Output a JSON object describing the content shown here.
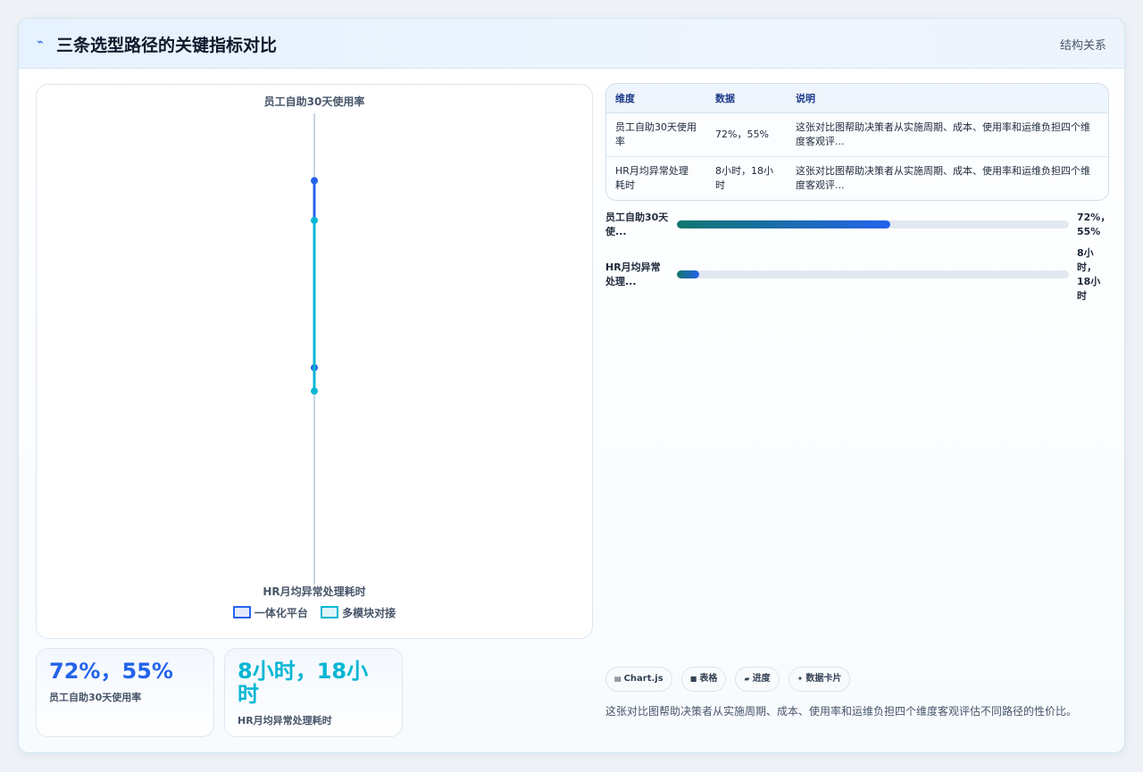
{
  "header": {
    "logo_icon": "spark-icon",
    "title": "三条选型路径的关键指标对比",
    "relation_link": "结构关系"
  },
  "chart_data": {
    "type": "radar",
    "axes": [
      "员工自助30天使用率",
      "HR月均异常处理耗时"
    ],
    "series": [
      {
        "name": "一体化平台",
        "values": [
          72,
          8
        ],
        "color": "#2563eb"
      },
      {
        "name": "多模块对接",
        "values": [
          55,
          18
        ],
        "color": "#06b6d4"
      }
    ],
    "legend_position": "bottom"
  },
  "kpis": [
    {
      "value": "72%，55%",
      "label": "员工自助30天使用率",
      "color": "#2563eb"
    },
    {
      "value": "8小时，18小时",
      "label": "HR月均异常处理耗时",
      "color": "#06b6d4"
    }
  ],
  "table": {
    "headers": [
      "维度",
      "数据",
      "说明"
    ],
    "rows": [
      {
        "dimension": "员工自助30天使用率",
        "data": "72%，55%",
        "note": "这张对比图帮助决策者从实施周期、成本、使用率和运维负担四个维度客观评..."
      },
      {
        "dimension": "HR月均异常处理耗时",
        "data": "8小时，18小时",
        "note": "这张对比图帮助决策者从实施周期、成本、使用率和运维负担四个维度客观评..."
      }
    ]
  },
  "progress": [
    {
      "label": "员工自助30天使...",
      "value": "72%，55%",
      "fill": 0.545
    },
    {
      "label": "HR月均异常处理...",
      "value": "8小时，18小时",
      "fill": 0.057
    }
  ],
  "chips": [
    {
      "icon": "chart-icon",
      "glyph": "▤",
      "label": "Chart.js"
    },
    {
      "icon": "table-icon",
      "glyph": "■",
      "label": "表格"
    },
    {
      "icon": "progress-icon",
      "glyph": "▰",
      "label": "进度"
    },
    {
      "icon": "card-icon",
      "glyph": "✦",
      "label": "数据卡片"
    }
  ],
  "description": "这张对比图帮助决策者从实施周期、成本、使用率和运维负担四个维度客观评估不同路径的性价比。"
}
